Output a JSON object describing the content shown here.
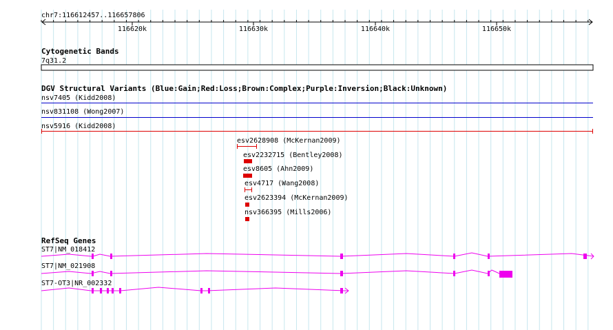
{
  "ruler": {
    "range_label": "chr7:116612457..116657806",
    "ticks": [
      "116620k",
      "116630k",
      "116640k",
      "116650k"
    ]
  },
  "cytoband": {
    "title": "Cytogenetic Bands",
    "band": "7q31.2"
  },
  "dgv": {
    "title": "DGV Structural Variants (Blue:Gain;Red:Loss;Brown:Complex;Purple:Inversion;Black:Unknown)",
    "colors": {
      "gain": "#0000cc",
      "loss": "#dd0000"
    },
    "variants": [
      {
        "label": "nsv7405 (Kidd2008)",
        "type": "gain"
      },
      {
        "label": "nsv831108 (Wong2007)",
        "type": "gain"
      },
      {
        "label": "nsv5916 (Kidd2008)",
        "type": "loss"
      },
      {
        "label": "esv2628908 (McKernan2009)",
        "type": "loss"
      },
      {
        "label": "esv2232715 (Bentley2008)",
        "type": "loss"
      },
      {
        "label": "esv8605 (Ahn2009)",
        "type": "loss"
      },
      {
        "label": "esv4717 (Wang2008)",
        "type": "loss"
      },
      {
        "label": "esv2623394 (McKernan2009)",
        "type": "loss"
      },
      {
        "label": "nsv366395 (Mills2006)",
        "type": "loss"
      }
    ]
  },
  "refseq": {
    "title": "RefSeq Genes",
    "color": "#ee00ee",
    "genes": [
      {
        "label": "ST7|NM_018412"
      },
      {
        "label": "ST7|NM_021908"
      },
      {
        "label": "ST7-OT3|NR_002332"
      }
    ]
  }
}
